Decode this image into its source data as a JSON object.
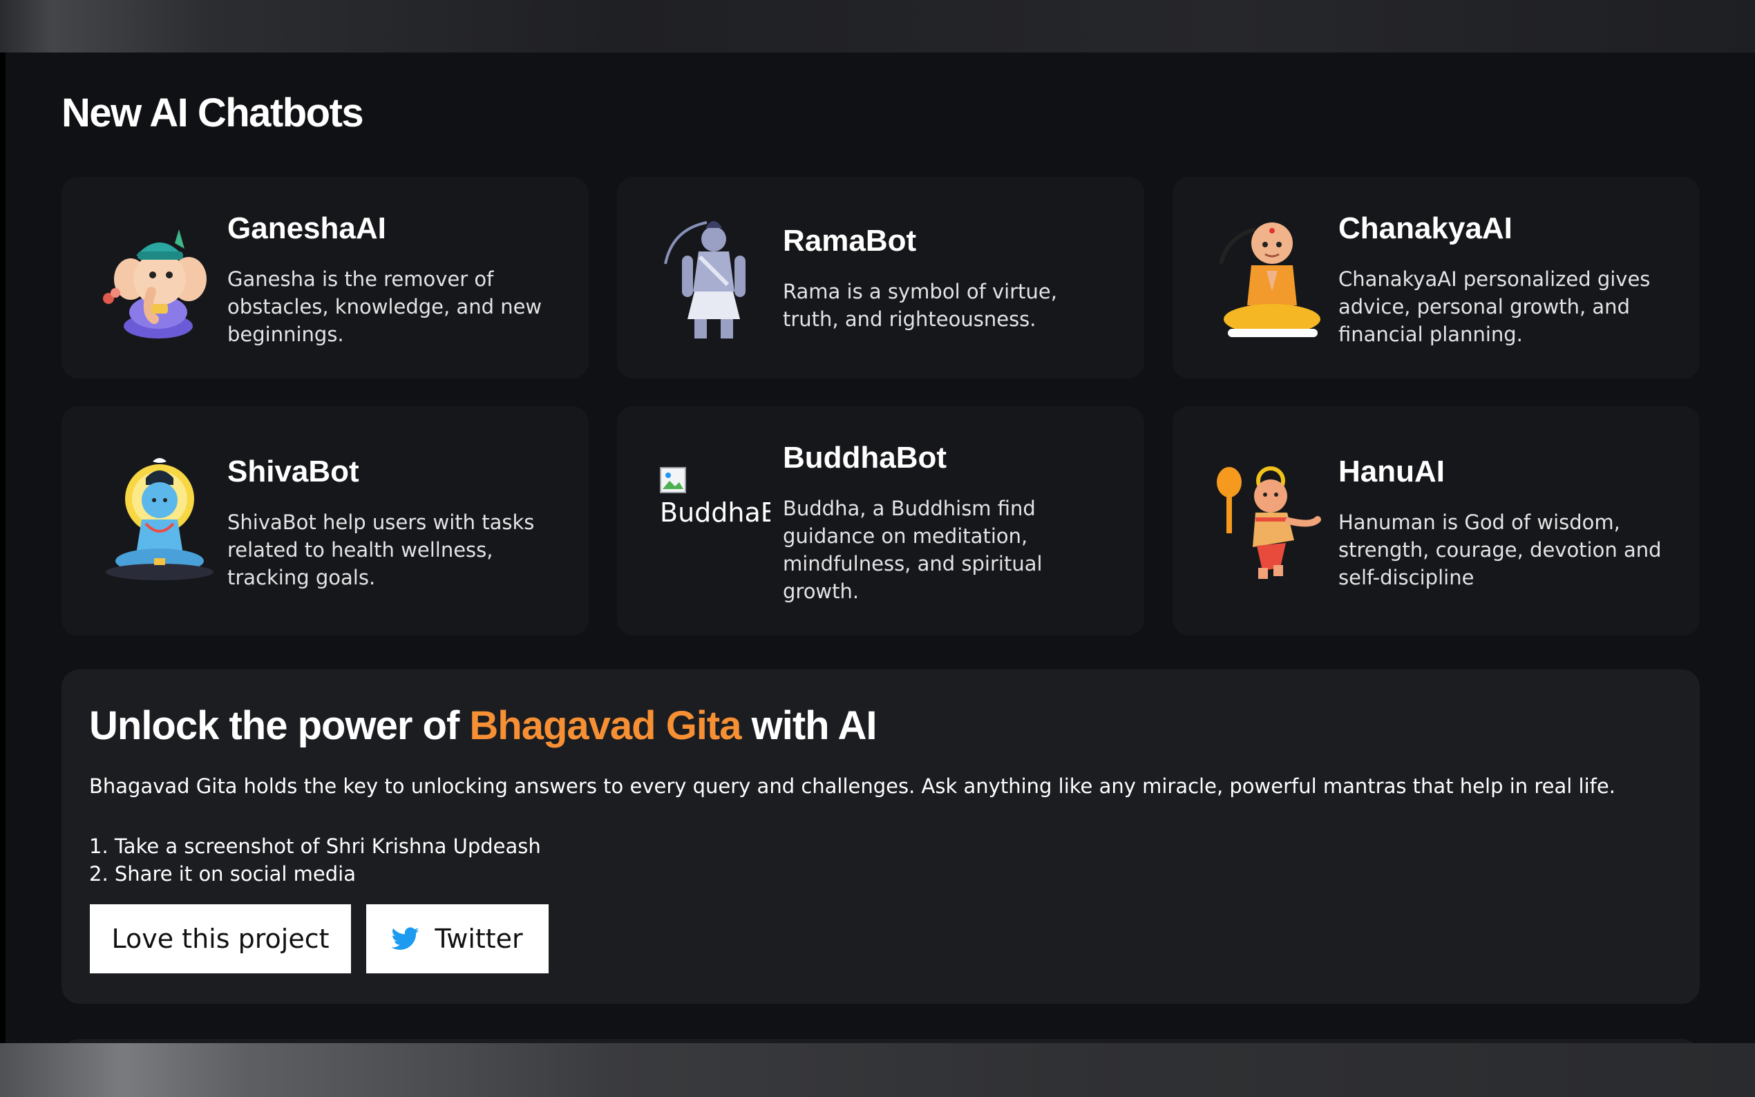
{
  "section": {
    "title": "New AI Chatbots"
  },
  "bots": [
    {
      "name": "GaneshaAI",
      "description": "Ganesha is the remover of obstacles, knowledge, and new beginnings.",
      "icon": "ganesha-avatar-icon"
    },
    {
      "name": "RamaBot",
      "description": "Rama is a symbol of virtue, truth, and righteousness.",
      "icon": "rama-avatar-icon"
    },
    {
      "name": "ChanakyaAI",
      "description": "ChanakyaAI personalized gives advice, personal growth, and financial planning.",
      "icon": "chanakya-avatar-icon"
    },
    {
      "name": "ShivaBot",
      "description": "ShivaBot help users with tasks related to health wellness, tracking goals.",
      "icon": "shiva-avatar-icon"
    },
    {
      "name": "BuddhaBot",
      "description": "Buddha, a Buddhism find guidance on meditation, mindfulness, and spiritual growth.",
      "icon": "broken-image-icon",
      "image_alt": "BuddhaB"
    },
    {
      "name": "HanuAI",
      "description": "Hanuman is God of wisdom, strength, courage, devotion and self-discipline",
      "icon": "hanuman-avatar-icon"
    }
  ],
  "promo": {
    "title_prefix": "Unlock the power of ",
    "title_accent": "Bhagavad Gita",
    "title_suffix": " with AI",
    "description": "Bhagavad Gita holds the key to unlocking answers to every query and challenges. Ask anything like any miracle, powerful mantras that help in real life.",
    "steps": [
      "1. Take a screenshot of Shri Krishna Updeash",
      "2. Share it on social media"
    ],
    "love_button": "Love this project",
    "twitter_button": "Twitter"
  },
  "colors": {
    "accent": "#f79034",
    "background": "#101114",
    "card": "#16171a",
    "panel": "#1c1d21",
    "twitter": "#1d9bf0"
  }
}
